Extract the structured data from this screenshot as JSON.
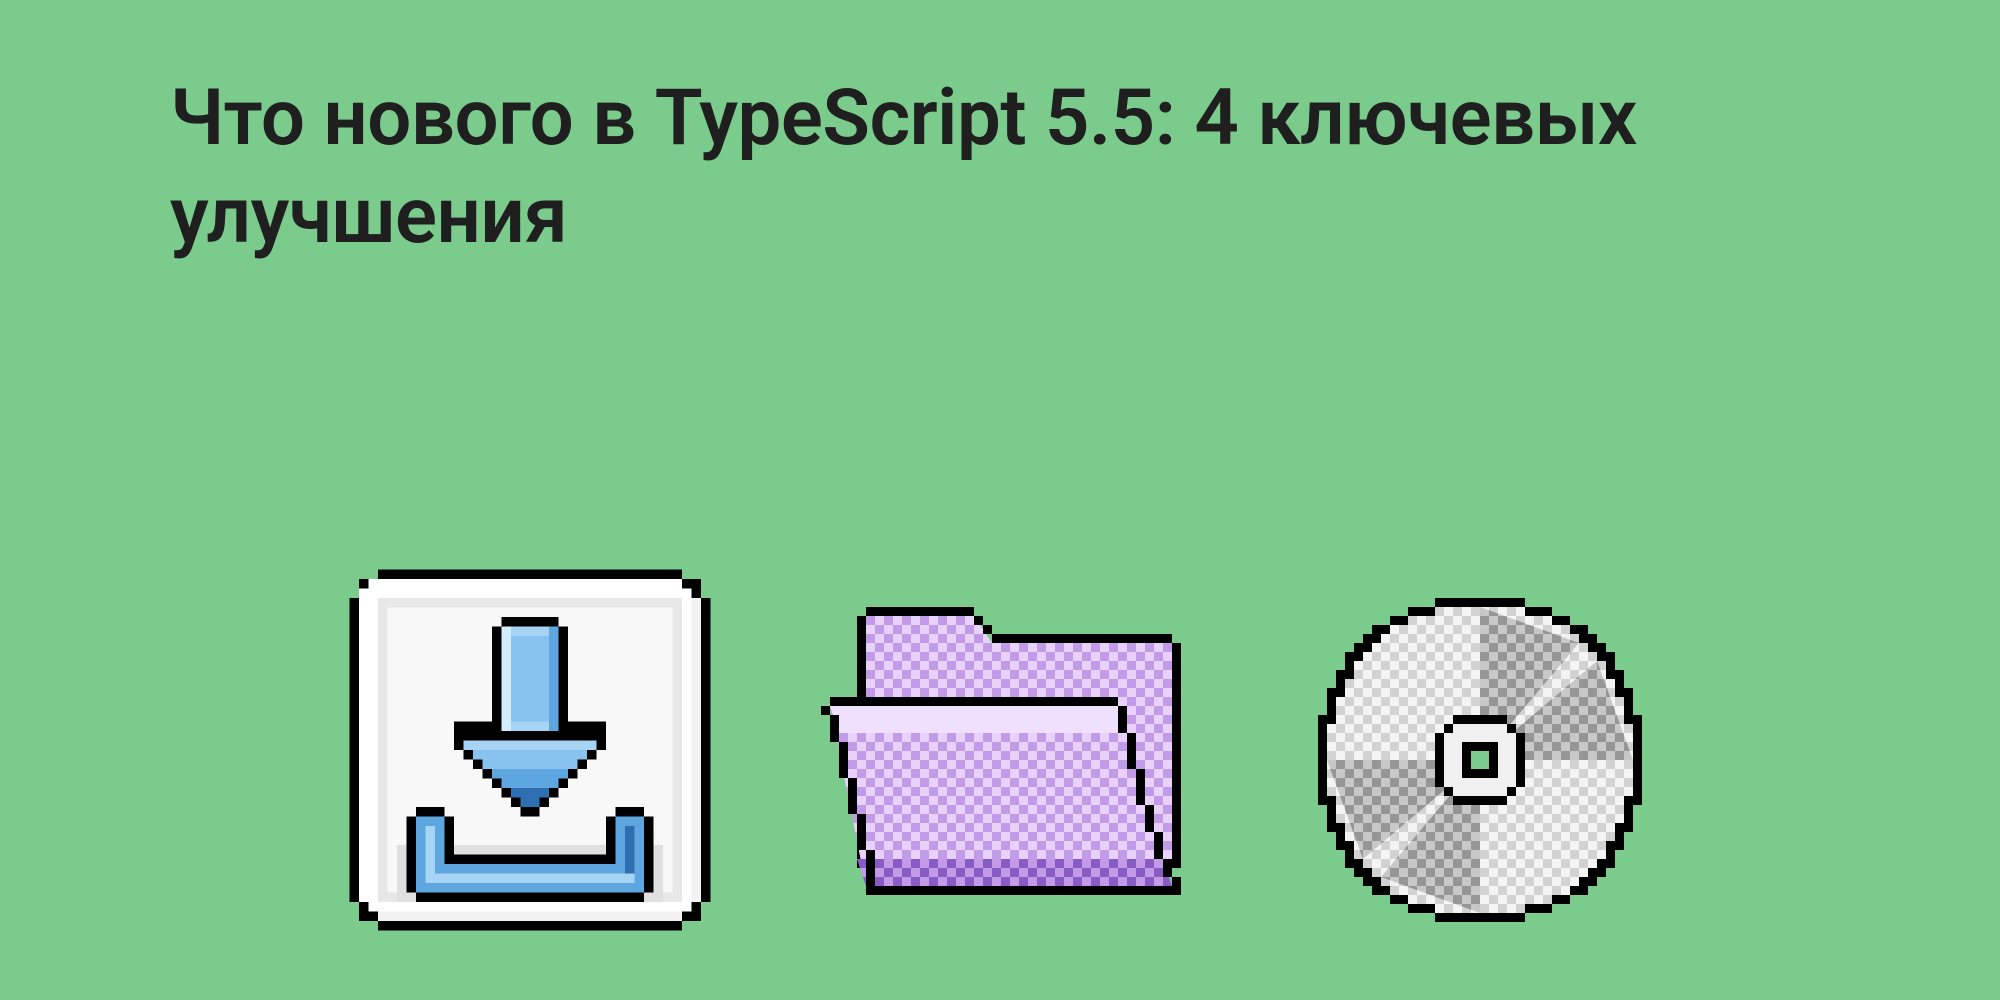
{
  "title": "Что нового в TypeScript 5.5: 4 ключевых улучшения",
  "icons": {
    "download": "download-icon",
    "folder": "folder-icon",
    "disc": "disc-icon"
  },
  "colors": {
    "background": "#7bcb8d",
    "text": "#1f1f1f",
    "download_blue_light": "#a7d3f5",
    "download_blue_mid": "#5ea6e0",
    "download_blue_dark": "#2d6fb0",
    "folder_purple_light": "#e1c4f8",
    "folder_purple_mid": "#c19ae8",
    "folder_purple_dark": "#8a5bc4",
    "disc_grey_light": "#eaeaea",
    "disc_grey_mid": "#b8b8b8",
    "disc_grey_dark": "#8a8a8a"
  }
}
